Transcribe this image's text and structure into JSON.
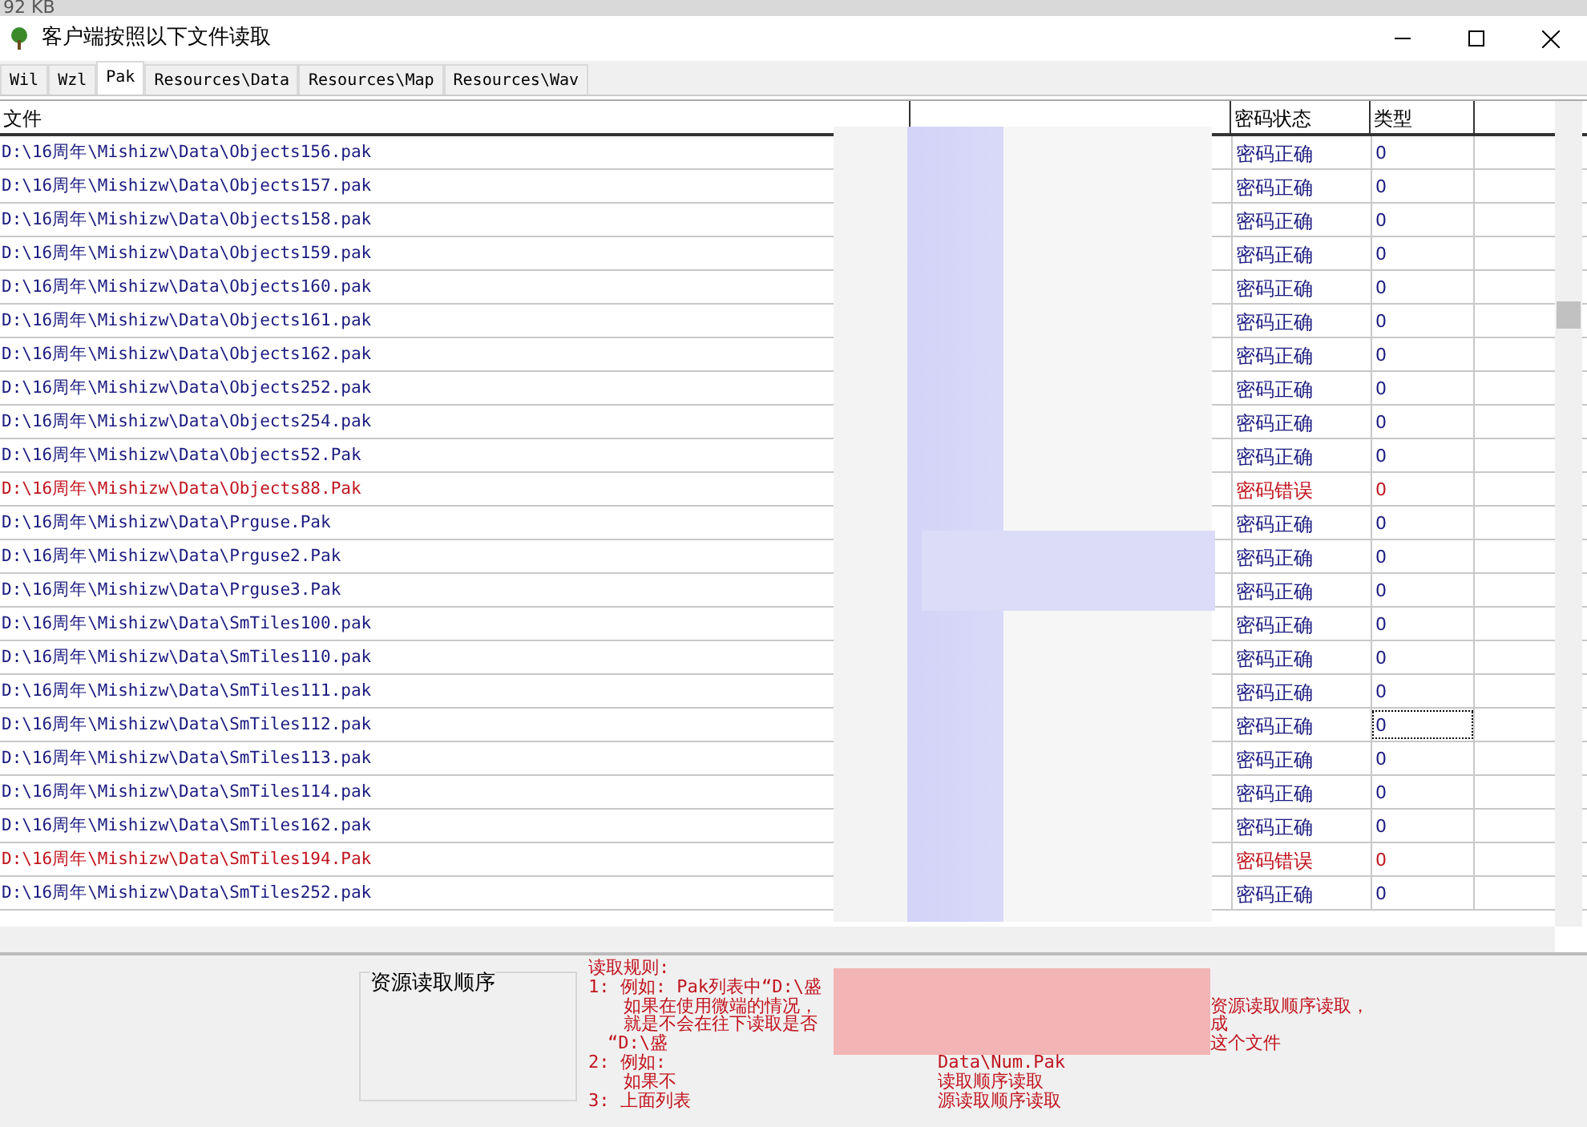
{
  "background_text": "92 KB",
  "window": {
    "title": "客户端按照以下文件读取"
  },
  "tabs": [
    {
      "label": "Wil",
      "selected": false
    },
    {
      "label": "Wzl",
      "selected": false
    },
    {
      "label": "Pak",
      "selected": true
    },
    {
      "label": "Resources\\Data",
      "selected": false
    },
    {
      "label": "Resources\\Map",
      "selected": false
    },
    {
      "label": "Resources\\Wav",
      "selected": false
    }
  ],
  "table": {
    "columns": [
      "文件",
      "密码状态",
      "类型"
    ],
    "rows": [
      {
        "file": "D:\\16周年\\Mishizw\\Data\\Objects156.pak",
        "status": "密码正确",
        "type": "0",
        "error": false,
        "focused": false
      },
      {
        "file": "D:\\16周年\\Mishizw\\Data\\Objects157.pak",
        "status": "密码正确",
        "type": "0",
        "error": false,
        "focused": false
      },
      {
        "file": "D:\\16周年\\Mishizw\\Data\\Objects158.pak",
        "status": "密码正确",
        "type": "0",
        "error": false,
        "focused": false
      },
      {
        "file": "D:\\16周年\\Mishizw\\Data\\Objects159.pak",
        "status": "密码正确",
        "type": "0",
        "error": false,
        "focused": false
      },
      {
        "file": "D:\\16周年\\Mishizw\\Data\\Objects160.pak",
        "status": "密码正确",
        "type": "0",
        "error": false,
        "focused": false
      },
      {
        "file": "D:\\16周年\\Mishizw\\Data\\Objects161.pak",
        "status": "密码正确",
        "type": "0",
        "error": false,
        "focused": false
      },
      {
        "file": "D:\\16周年\\Mishizw\\Data\\Objects162.pak",
        "status": "密码正确",
        "type": "0",
        "error": false,
        "focused": false
      },
      {
        "file": "D:\\16周年\\Mishizw\\Data\\Objects252.pak",
        "status": "密码正确",
        "type": "0",
        "error": false,
        "focused": false
      },
      {
        "file": "D:\\16周年\\Mishizw\\Data\\Objects254.pak",
        "status": "密码正确",
        "type": "0",
        "error": false,
        "focused": false
      },
      {
        "file": "D:\\16周年\\Mishizw\\Data\\Objects52.Pak",
        "status": "密码正确",
        "type": "0",
        "error": false,
        "focused": false
      },
      {
        "file": "D:\\16周年\\Mishizw\\Data\\Objects88.Pak",
        "status": "密码错误",
        "type": "0",
        "error": true,
        "focused": false
      },
      {
        "file": "D:\\16周年\\Mishizw\\Data\\Prguse.Pak",
        "status": "密码正确",
        "type": "0",
        "error": false,
        "focused": false
      },
      {
        "file": "D:\\16周年\\Mishizw\\Data\\Prguse2.Pak",
        "status": "密码正确",
        "type": "0",
        "error": false,
        "focused": false
      },
      {
        "file": "D:\\16周年\\Mishizw\\Data\\Prguse3.Pak",
        "status": "密码正确",
        "type": "0",
        "error": false,
        "focused": false
      },
      {
        "file": "D:\\16周年\\Mishizw\\Data\\SmTiles100.pak",
        "status": "密码正确",
        "type": "0",
        "error": false,
        "focused": false
      },
      {
        "file": "D:\\16周年\\Mishizw\\Data\\SmTiles110.pak",
        "status": "密码正确",
        "type": "0",
        "error": false,
        "focused": false
      },
      {
        "file": "D:\\16周年\\Mishizw\\Data\\SmTiles111.pak",
        "status": "密码正确",
        "type": "0",
        "error": false,
        "focused": false
      },
      {
        "file": "D:\\16周年\\Mishizw\\Data\\SmTiles112.pak",
        "status": "密码正确",
        "type": "0",
        "error": false,
        "focused": true
      },
      {
        "file": "D:\\16周年\\Mishizw\\Data\\SmTiles113.pak",
        "status": "密码正确",
        "type": "0",
        "error": false,
        "focused": false
      },
      {
        "file": "D:\\16周年\\Mishizw\\Data\\SmTiles114.pak",
        "status": "密码正确",
        "type": "0",
        "error": false,
        "focused": false
      },
      {
        "file": "D:\\16周年\\Mishizw\\Data\\SmTiles162.pak",
        "status": "密码正确",
        "type": "0",
        "error": false,
        "focused": false
      },
      {
        "file": "D:\\16周年\\Mishizw\\Data\\SmTiles194.Pak",
        "status": "密码错误",
        "type": "0",
        "error": true,
        "focused": false
      },
      {
        "file": "D:\\16周年\\Mishizw\\Data\\SmTiles252.pak",
        "status": "密码正确",
        "type": "0",
        "error": false,
        "focused": false
      }
    ]
  },
  "group": {
    "title": "资源读取顺序"
  },
  "rules": [
    {
      "kind": "head",
      "text": "读取规则:"
    },
    {
      "kind": "item",
      "text": "1: 例如: Pak列表中“D:\\盛"
    },
    {
      "kind": "cont",
      "text": "如果在使用微端的情况，",
      "tail": "资源读取顺序读取，",
      "wide_gap": true
    },
    {
      "kind": "cont",
      "text": "就是不会在往下读取是否",
      "tail": "成",
      "wide_gap": true
    },
    {
      "kind": "half",
      "text": "“D:\\盛",
      "tail": "这个文件",
      "wide_gap": true
    },
    {
      "kind": "item",
      "text": "2: 例如:",
      "tail": "Data\\Num.Pak"
    },
    {
      "kind": "cont",
      "text": "如果不",
      "tail": "读取顺序读取"
    },
    {
      "kind": "item",
      "text": "3: 上面列表",
      "tail": "源读取顺序读取"
    }
  ]
}
